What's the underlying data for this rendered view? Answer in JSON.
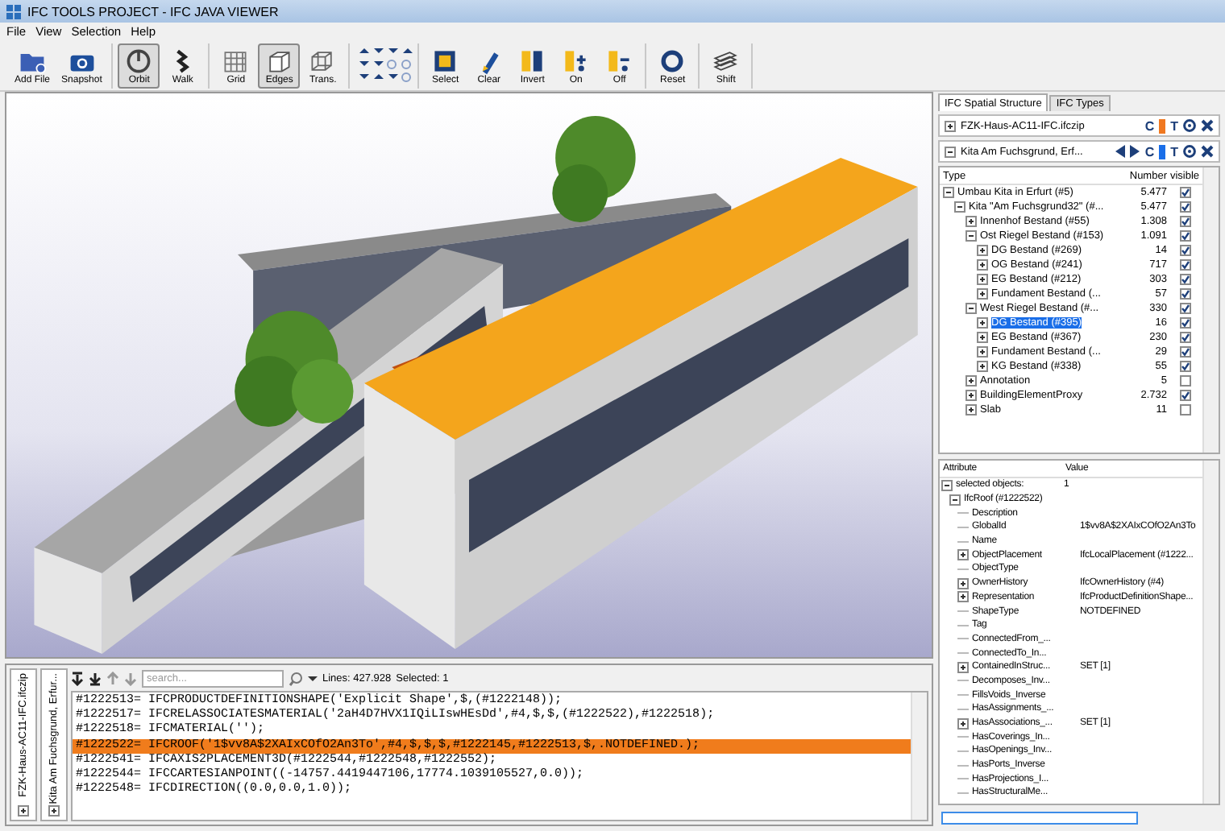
{
  "window": {
    "title": "IFC TOOLS PROJECT - IFC JAVA VIEWER"
  },
  "menu": [
    "File",
    "View",
    "Selection",
    "Help"
  ],
  "toolbar": {
    "groups": [
      {
        "kind": "buttons",
        "buttons": [
          {
            "label": "Add File",
            "selected": false
          },
          {
            "label": "Snapshot",
            "selected": false
          }
        ]
      },
      {
        "kind": "buttons",
        "buttons": [
          {
            "label": "Orbit",
            "selected": true
          },
          {
            "label": "Walk",
            "selected": false
          }
        ]
      },
      {
        "kind": "buttons",
        "buttons": [
          {
            "label": "Grid",
            "selected": false
          },
          {
            "label": "Edges",
            "selected": true
          },
          {
            "label": "Trans.",
            "selected": false
          }
        ]
      },
      {
        "kind": "navigation"
      },
      {
        "kind": "buttons",
        "buttons": [
          {
            "label": "Select",
            "selected": false
          },
          {
            "label": "Clear",
            "selected": false
          },
          {
            "label": "Invert",
            "selected": false
          },
          {
            "label": "On",
            "selected": false
          },
          {
            "label": "Off",
            "selected": false
          }
        ]
      },
      {
        "kind": "buttons",
        "buttons": [
          {
            "label": "Reset",
            "selected": false
          }
        ]
      },
      {
        "kind": "buttons",
        "buttons": [
          {
            "label": "Shift",
            "selected": false
          }
        ]
      }
    ]
  },
  "console": {
    "side_tabs": [
      {
        "label": "FZK-Haus-AC11-IFC.ifczip"
      },
      {
        "label": "Kita Am Fuchsgrund, Erfur..."
      }
    ],
    "search": {
      "placeholder": "search..."
    },
    "lines": "Lines: 427.928",
    "selected_count": "Selected: 1",
    "code_lines": [
      {
        "text": "#1222513= IFCPRODUCTDEFINITIONSHAPE('Explicit Shape',$,(#1222148));",
        "selected": false
      },
      {
        "text": "#1222517= IFCRELASSOCIATESMATERIAL('2aH4D7HVX1IQiLIswHEsDd',#4,$,$,(#1222522),#1222518);",
        "selected": false
      },
      {
        "text": "#1222518= IFCMATERIAL('');",
        "selected": false
      },
      {
        "text": "#1222522= IFCROOF('1$vv8A$2XAIxCOfO2An3To',#4,$,$,$,#1222145,#1222513,$,.NOTDEFINED.);",
        "selected": true
      },
      {
        "text": "#1222541= IFCAXIS2PLACEMENT3D(#1222544,#1222548,#1222552);",
        "selected": false
      },
      {
        "text": "#1222544= IFCCARTESIANPOINT((-14757.4419447106,17774.1039105527,0.0));",
        "selected": false
      },
      {
        "text": "#1222548= IFCDIRECTION((0.0,0.0,1.0));",
        "selected": false
      }
    ]
  },
  "side_panel": {
    "tabs": [
      {
        "label": "IFC Spatial Structure",
        "selected": true
      },
      {
        "label": "IFC Types",
        "selected": false
      }
    ],
    "models": [
      {
        "name": "FZK-Haus-AC11-IFC.ifczip",
        "expanded": false,
        "navigable": false,
        "color": "#f07820",
        "controls": [
          "C",
          "T"
        ]
      },
      {
        "name": "Kita Am Fuchsgrund, Erf...",
        "expanded": true,
        "navigable": true,
        "color": "#1a6ee8",
        "controls": [
          "C",
          "T"
        ]
      }
    ],
    "tree": {
      "columns": [
        "Type",
        "Number",
        "visible"
      ],
      "rows": [
        {
          "name": "Umbau Kita in Erfurt (#5)",
          "number": "5.477",
          "visible": true,
          "expanded": true,
          "selected": false,
          "children": [
            {
              "name": "Kita \"Am Fuchsgrund32\" (#...",
              "number": "5.477",
              "visible": true,
              "expanded": true,
              "selected": false,
              "children": [
                {
                  "name": "Innenhof Bestand (#55)",
                  "number": "1.308",
                  "visible": true,
                  "expanded": false,
                  "selected": false
                },
                {
                  "name": "Ost Riegel Bestand (#153)",
                  "number": "1.091",
                  "visible": true,
                  "expanded": true,
                  "selected": false,
                  "children": [
                    {
                      "name": "DG Bestand (#269)",
                      "number": "14",
                      "visible": true,
                      "expanded": false,
                      "selected": false
                    },
                    {
                      "name": "OG Bestand (#241)",
                      "number": "717",
                      "visible": true,
                      "expanded": false,
                      "selected": false
                    },
                    {
                      "name": "EG Bestand (#212)",
                      "number": "303",
                      "visible": true,
                      "expanded": false,
                      "selected": false
                    },
                    {
                      "name": "Fundament Bestand (...",
                      "number": "57",
                      "visible": true,
                      "expanded": false,
                      "selected": false
                    }
                  ]
                },
                {
                  "name": "West Riegel Bestand (#...",
                  "number": "330",
                  "visible": true,
                  "expanded": true,
                  "selected": false,
                  "children": [
                    {
                      "name": "DG Bestand (#395)",
                      "number": "16",
                      "visible": true,
                      "expanded": false,
                      "selected": true
                    },
                    {
                      "name": "EG Bestand (#367)",
                      "number": "230",
                      "visible": true,
                      "expanded": false,
                      "selected": false
                    },
                    {
                      "name": "Fundament Bestand (...",
                      "number": "29",
                      "visible": true,
                      "expanded": false,
                      "selected": false
                    },
                    {
                      "name": "KG Bestand (#338)",
                      "number": "55",
                      "visible": true,
                      "expanded": false,
                      "selected": false
                    }
                  ]
                },
                {
                  "name": "Annotation",
                  "number": "5",
                  "visible": false,
                  "expanded": false,
                  "selected": false
                },
                {
                  "name": "BuildingElementProxy",
                  "number": "2.732",
                  "visible": true,
                  "expanded": false,
                  "selected": false
                },
                {
                  "name": "Slab",
                  "number": "11",
                  "visible": false,
                  "expanded": false,
                  "selected": false
                }
              ]
            }
          ]
        }
      ]
    }
  },
  "attributes": {
    "columns": [
      "Attribute",
      "Value"
    ],
    "rows": [
      {
        "name": "selected objects:",
        "value": "1",
        "expanded": true,
        "children": [
          {
            "name": "IfcRoof (#1222522)",
            "expanded": true,
            "children": [
              {
                "name": "Description"
              },
              {
                "name": "GlobalId",
                "value": "1$vv8A$2XAIxCOfO2An3To"
              },
              {
                "name": "Name"
              },
              {
                "name": "ObjectPlacement",
                "value": "IfcLocalPlacement (#1222...",
                "expanded": false
              },
              {
                "name": "ObjectType"
              },
              {
                "name": "OwnerHistory",
                "value": "IfcOwnerHistory (#4)",
                "expanded": false
              },
              {
                "name": "Representation",
                "value": "IfcProductDefinitionShape...",
                "expanded": false
              },
              {
                "name": "ShapeType",
                "value": "NOTDEFINED"
              },
              {
                "name": "Tag"
              },
              {
                "name": "ConnectedFrom_..."
              },
              {
                "name": "ConnectedTo_In..."
              },
              {
                "name": "ContainedInStruc...",
                "value": "SET [1]",
                "expanded": false
              },
              {
                "name": "Decomposes_Inv..."
              },
              {
                "name": "FillsVoids_Inverse"
              },
              {
                "name": "HasAssignments_..."
              },
              {
                "name": "HasAssociations_...",
                "value": "SET [1]",
                "expanded": false
              },
              {
                "name": "HasCoverings_In..."
              },
              {
                "name": "HasOpenings_Inv..."
              },
              {
                "name": "HasPorts_Inverse"
              },
              {
                "name": "HasProjections_I..."
              },
              {
                "name": "HasStructuralMe..."
              }
            ]
          }
        ]
      }
    ]
  }
}
